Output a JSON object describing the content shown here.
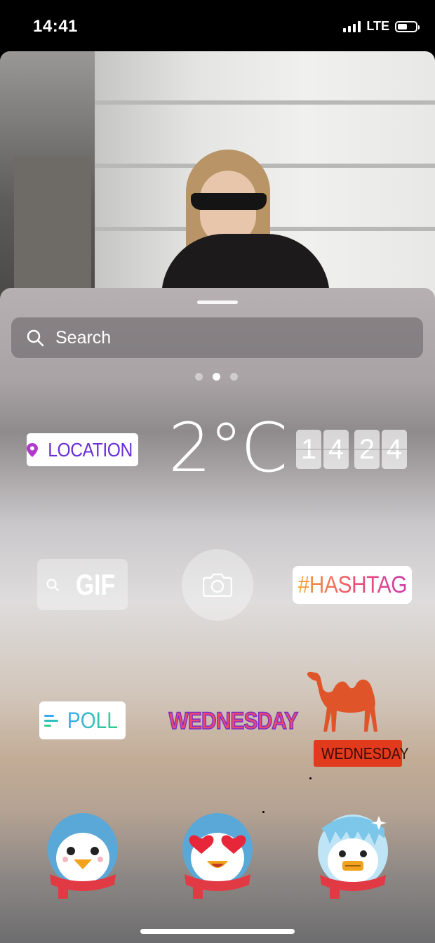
{
  "status_bar": {
    "time": "14:41",
    "network": "LTE",
    "icons": [
      "signal-icon",
      "battery-icon"
    ]
  },
  "photo": {
    "description_icon": "story-photo"
  },
  "tray": {
    "search_placeholder": "Search",
    "page_dots": {
      "count": 3,
      "active": 2
    },
    "stickers": {
      "location": "LOCATION",
      "temperature": "2°C",
      "clock_digits": [
        "1",
        "4",
        "2",
        "4"
      ],
      "gif": "GIF",
      "camera_icon": "camera-icon",
      "hashtag": "#HASHTAG",
      "poll": "POLL",
      "day_text": "WEDNESDAY",
      "camel_label": "WEDNESDAY",
      "penguins": [
        "penguin-scarf-icon",
        "penguin-heart-eyes-icon",
        "penguin-frozen-icon"
      ]
    }
  },
  "colors": {
    "location_text": "#6a2fd6",
    "hashtag_gradient": [
      "#f6a034",
      "#ee5570",
      "#cc3ba8"
    ],
    "poll_gradient": [
      "#3aa8f0",
      "#2ed08a"
    ],
    "camel": "#e0542a",
    "camel_tag": "#e23a1c"
  }
}
